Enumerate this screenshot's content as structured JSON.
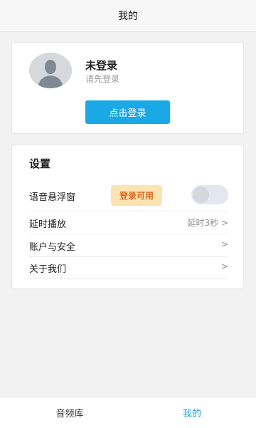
{
  "header": {
    "title": "我的"
  },
  "profile": {
    "title": "未登录",
    "subtitle": "请先登录",
    "login_button": "点击登录"
  },
  "settings": {
    "title": "设置",
    "rows": [
      {
        "label": "语音悬浮窗",
        "badge": "登录可用",
        "toggle": false
      },
      {
        "label": "延时播放",
        "value": "延时3秒 >"
      },
      {
        "label": "账户与安全",
        "chevron": ">"
      },
      {
        "label": "关于我们",
        "chevron": ">"
      }
    ]
  },
  "tabs": [
    {
      "label": "音频库",
      "active": false
    },
    {
      "label": "我的",
      "active": true
    }
  ],
  "colors": {
    "accent": "#1aa8e6",
    "active_tab": "#1a9ee0",
    "badge_bg": "#fde2b2",
    "badge_text": "#d8661c"
  }
}
